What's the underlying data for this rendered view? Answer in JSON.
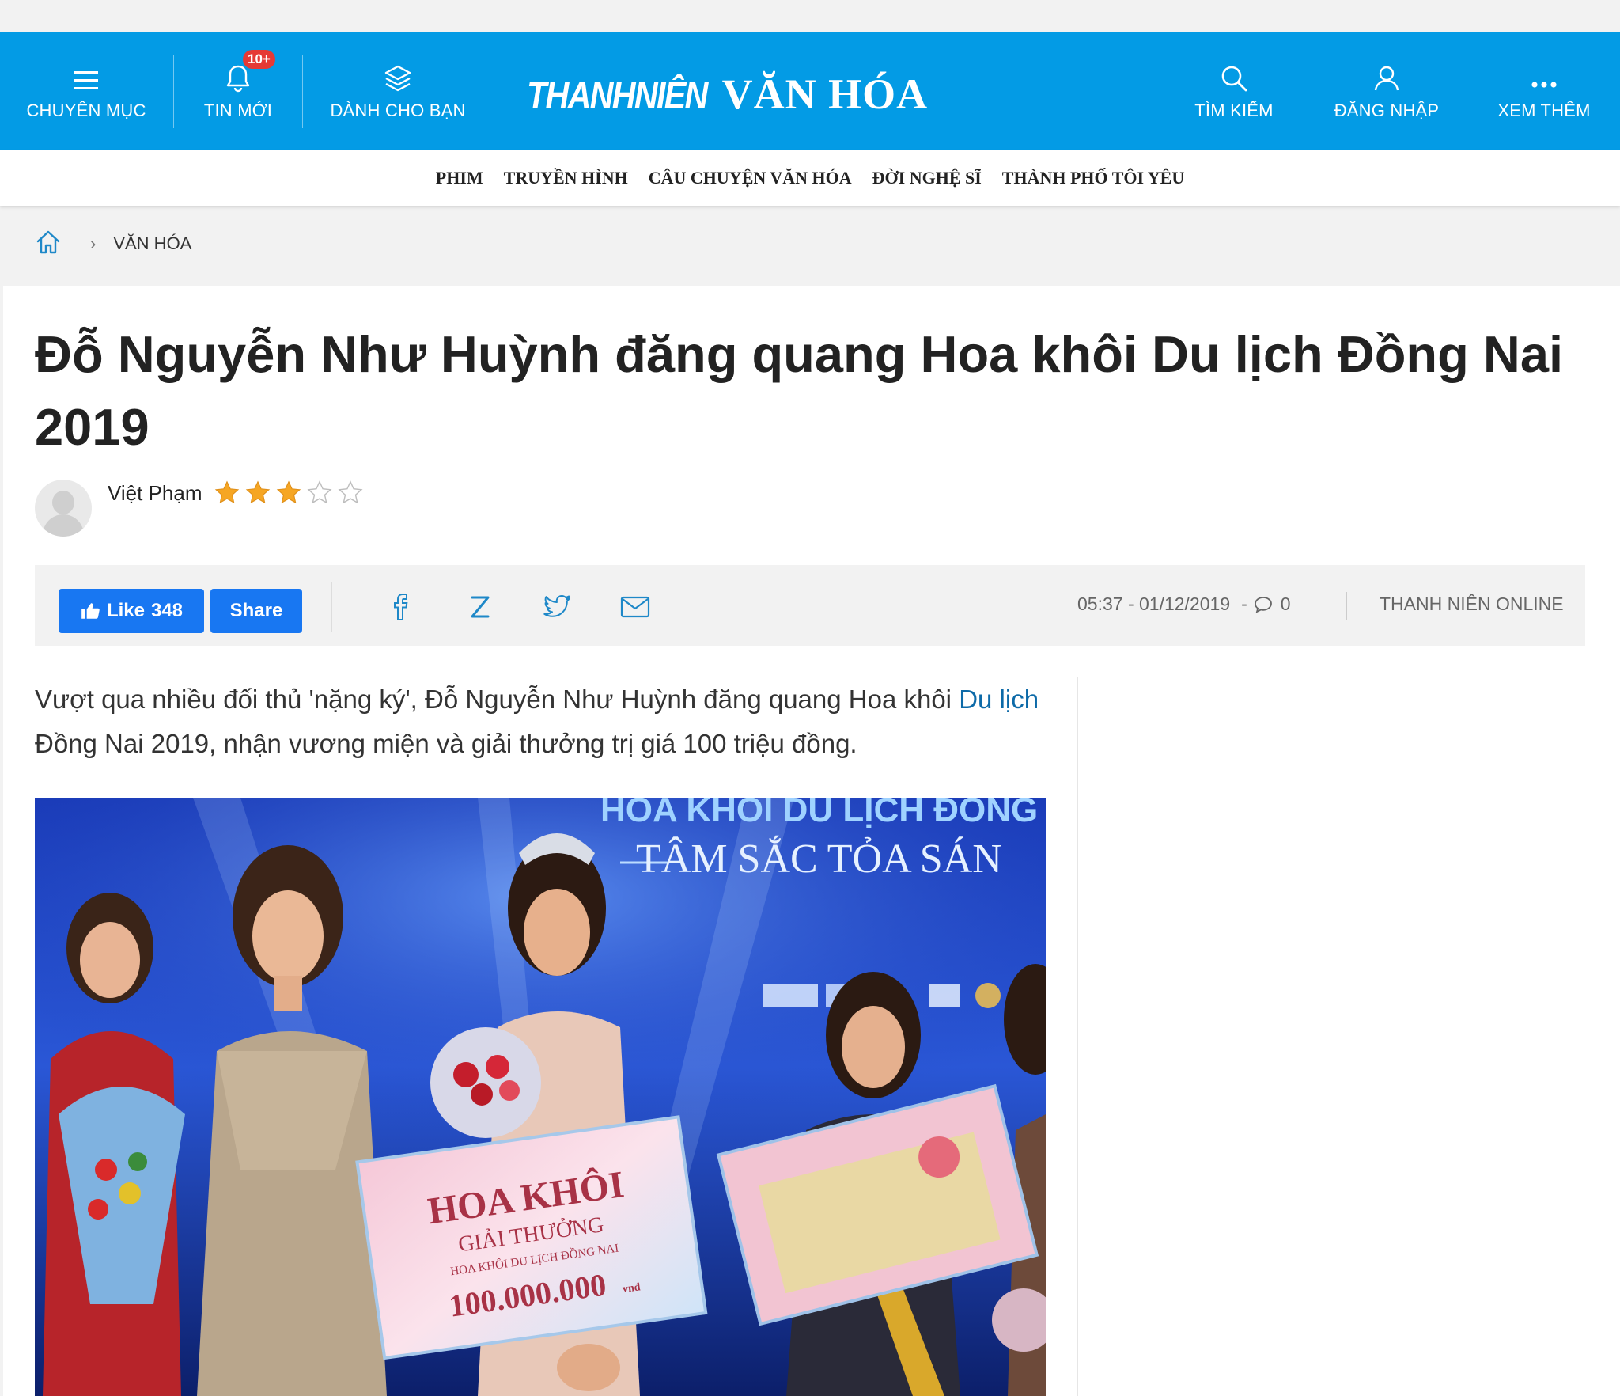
{
  "header": {
    "nav_left": [
      {
        "label": "CHUYÊN MỤC",
        "icon": "menu-icon"
      },
      {
        "label": "TIN MỚI",
        "icon": "bell-icon",
        "badge": "10+"
      },
      {
        "label": "DÀNH CHO BẠN",
        "icon": "layers-icon"
      }
    ],
    "logo": {
      "part1": "THANHNIÊN",
      "part2": "VĂN HÓA"
    },
    "nav_right": [
      {
        "label": "TÌM KIẾM",
        "icon": "search-icon"
      },
      {
        "label": "ĐĂNG NHẬP",
        "icon": "user-icon"
      },
      {
        "label": "XEM THÊM",
        "icon": "more-icon"
      }
    ],
    "bg_color": "#039be5",
    "badge_color": "#e53935"
  },
  "subnav": [
    "PHIM",
    "TRUYỀN HÌNH",
    "CÂU CHUYỆN VĂN HÓA",
    "ĐỜI NGHỆ SĨ",
    "THÀNH PHỐ TÔI YÊU"
  ],
  "breadcrumb": {
    "home_icon": "home-icon",
    "separator": "›",
    "section": "VĂN HÓA"
  },
  "article": {
    "title": "Đỗ Nguyễn Như Huỳnh đăng quang Hoa khôi Du lịch Đồng Nai 2019",
    "author": "Việt Phạm",
    "rating": {
      "value": 3,
      "max": 5
    },
    "facebook": {
      "like_label": "Like",
      "like_count": "348",
      "share_label": "Share",
      "color": "#1877f2"
    },
    "share_icons": [
      "facebook-icon",
      "zalo-icon",
      "twitter-icon",
      "email-icon"
    ],
    "datetime": "05:37 - 01/12/2019",
    "dash": "-",
    "comment_count": "0",
    "source": "THANH NIÊN ONLINE",
    "lede": {
      "part1": "Vượt qua nhiều đối thủ 'nặng ký', Đỗ Nguyễn Như Huỳnh đăng quang Hoa khôi ",
      "link": "Du lịch",
      "part2": " Đồng Nai 2019, nhận vương miện và giải thưởng trị giá 100 triệu đồng.",
      "link_color": "#0d6aa8"
    },
    "photo": {
      "banner_line1": "HOA KHÔI DU LỊCH ĐỒNG",
      "banner_line2": "TÂM SẮC TỎA SÁN",
      "board_title": "HOA KHÔI",
      "board_sub1": "GIẢI THƯỞNG",
      "board_sub2": "HOA KHÔI DU LỊCH ĐỒNG NAI",
      "board_amount": "100.000.000",
      "board_unit": "vnđ"
    }
  }
}
